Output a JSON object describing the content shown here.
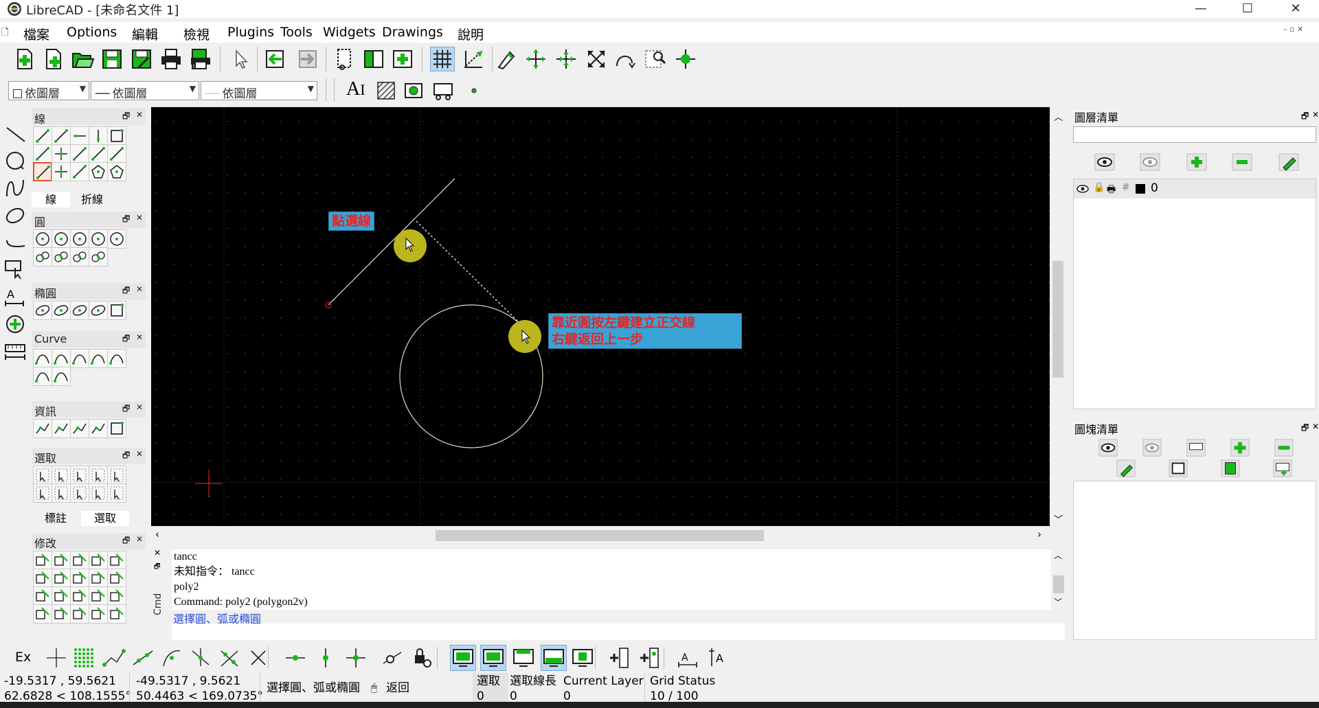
{
  "window": {
    "title": "LibreCAD - [未命名文件 1]",
    "minimize": "—",
    "maximize": "☐",
    "close": "✕"
  },
  "menu": [
    "檔案",
    "Options",
    "編輯",
    "檢視",
    "Plugins",
    "Tools",
    "Widgets",
    "Drawings",
    "說明"
  ],
  "pen_toolbar": {
    "color": "依圖層",
    "linetype": "依圖層",
    "width": "依圖層"
  },
  "left_panels": {
    "line": "線",
    "line_tab_a": "線",
    "line_tab_b": "折線",
    "circle": "圓",
    "ellipse": "橢圓",
    "curve": "Curve",
    "info": "資訊",
    "select": "選取",
    "select_tab_a": "標註",
    "select_tab_b": "選取",
    "modify": "修改"
  },
  "annotations": {
    "pick_line": "點選線",
    "near_circle_1": "靠近圓按左鍵建立正交線",
    "near_circle_2": "右鍵返回上一步"
  },
  "command": {
    "log": [
      "tancc",
      "未知指令： tancc",
      "poly2",
      "Command: poly2 (polygon2v)"
    ],
    "prompt": "選擇圓、弧或橢圓",
    "side_label": "Cmd",
    "input_value": ""
  },
  "layer_list": {
    "title": "圖層清單",
    "filter_placeholder": "",
    "layers": [
      {
        "name": "0"
      }
    ]
  },
  "block_list": {
    "title": "圖塊清單"
  },
  "snap_toolbar": {
    "ex_label": "Ex"
  },
  "status": {
    "abs_coord": "-19.5317 , 59.5621",
    "abs_polar": "62.6828 < 108.1555°",
    "rel_coord": "-49.5317 , 9.5621",
    "rel_polar": "50.4463 < 169.0735°",
    "prompt": "選擇圓、弧或橢圓",
    "back": "返回",
    "selected_label": "選取",
    "selected_value": "0",
    "sel_length_label": "選取線長",
    "sel_length_value": "0",
    "current_layer_label": "Current Layer",
    "current_layer_value": "0",
    "grid_status_label": "Grid Status",
    "grid_status_value": "10 / 100"
  },
  "colors": {
    "canvas_bg": "#000000",
    "annotation_bg": "#3aa3d6",
    "annotation_text": "#e12828",
    "cursor_halo": "#bcb51e",
    "snap_active": "#b9d7f0"
  }
}
